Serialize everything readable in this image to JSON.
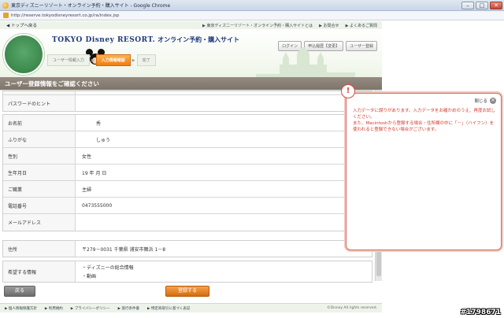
{
  "window": {
    "title": "東京ディズニーリゾート・オンライン予約・購入サイト - Google Chrome",
    "url": "http://reserve.tokyodisneyresort.co.jp/ra/index.jsp"
  },
  "topstrip": {
    "back_link": "◀ トップへ戻る",
    "links": [
      "▶ 東京ディズニーリゾート・オンライン予約・購入サイトとは",
      "▶ お問合せ",
      "▶ よくあるご質問"
    ]
  },
  "header": {
    "brand": "TOKYO Disney RESORT.",
    "subtitle": "オンライン予約・購入サイト",
    "steps": [
      "ユーザー情報入力",
      "入力情報確認",
      "完了"
    ],
    "buttons": [
      "ログイン",
      "申込履歴【変更】",
      "ユーザー登録"
    ]
  },
  "section_title": "ユーザー登録情報をご確認ください",
  "form_top": [
    {
      "label": "パスワードのヒント",
      "value": ""
    }
  ],
  "form_main": [
    {
      "label": "お名前",
      "value": "秀"
    },
    {
      "label": "ふりがな",
      "value": "しゅう"
    },
    {
      "label": "性別",
      "value": "女性"
    },
    {
      "label": "生年月日",
      "value": "19 年 月 日"
    },
    {
      "label": "ご職業",
      "value": "主婦"
    },
    {
      "label": "電話番号",
      "value": "0473555000"
    },
    {
      "label": "メールアドレス",
      "value": ""
    }
  ],
  "address": {
    "label": "住所",
    "value": "〒279－0031 千葉県 浦安市舞浜 1－8"
  },
  "wants": {
    "label": "希望する情報",
    "values": [
      "・ディズニーの総合情報",
      "・動画"
    ]
  },
  "actions": {
    "back": "戻る",
    "register": "登録する"
  },
  "footer": {
    "links": [
      "▶ 個人情報保護方針",
      "▶ 利用規約",
      "▶ プライバシーポリシー",
      "▶ 旅行条件書",
      "▶ 特定商取引に基づく表記"
    ],
    "copyright": "©Disney All rights reserved."
  },
  "dialog": {
    "close_label": "閉じる",
    "message_line1": "入力データに誤りがあります。入力データをお確かめのうえ、再度お試しください。",
    "message_line2": "また、Macintoshから登録する場合・住所欄の中に「－」（ハイフン）を使われると登録できない場合がございます。"
  },
  "watermark": "#1798671",
  "colors": {
    "section_bar": "#877e74",
    "accent_orange": "#e8821a",
    "error_red": "#d43a2b",
    "brand_blue": "#1e3a78"
  }
}
